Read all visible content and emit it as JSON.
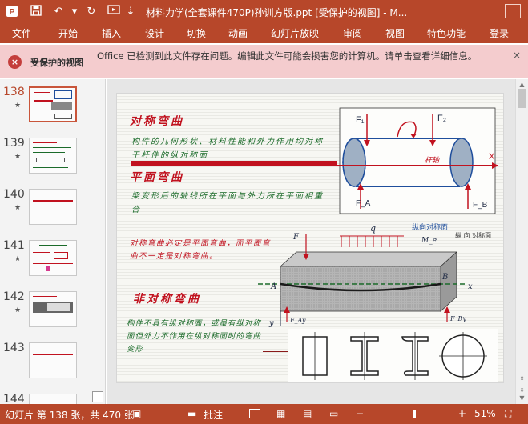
{
  "window": {
    "title": "材料力学(全套课件470P)孙训方版.ppt [受保护的视图] - M..."
  },
  "ribbon": {
    "tabs": [
      "文件",
      "开始",
      "插入",
      "设计",
      "切换",
      "动画",
      "幻灯片放映",
      "审阅",
      "视图",
      "特色功能",
      "登录"
    ]
  },
  "protected_view": {
    "title": "受保护的视图",
    "message": "Office 已检测到此文件存在问题。编辑此文件可能会损害您的计算机。请单击查看详细信息。",
    "close": "×"
  },
  "thumbnails": [
    {
      "number": "138",
      "star": "★",
      "selected": true
    },
    {
      "number": "139",
      "star": "★",
      "selected": false
    },
    {
      "number": "140",
      "star": "★",
      "selected": false
    },
    {
      "number": "141",
      "star": "★",
      "selected": false
    },
    {
      "number": "142",
      "star": "★",
      "selected": false
    },
    {
      "number": "143",
      "star": "",
      "selected": false
    },
    {
      "number": "144",
      "star": "",
      "selected": false
    }
  ],
  "slide": {
    "heading1": "对称弯曲",
    "text1": "构件的几何形状、材料性能和外力作用均对称于杆件的纵对称面",
    "heading2": "平面弯曲",
    "text2": "梁变形后的轴线所在平面与外力所在平面相重合",
    "text3": "对称弯曲必定是平面弯曲，而平面弯曲不一定是对称弯曲。",
    "heading3": "非对称弯曲",
    "text4": "构件不具有纵对称面，或虽有纵对称面但外力不作用在纵对称面时的弯曲变形",
    "fig1": {
      "F1": "F₁",
      "F2": "F₂",
      "FA": "F_A",
      "FB": "F_B",
      "axis_label": "杆轴",
      "x_label": "X"
    },
    "fig2": {
      "plane_label": "纵向对称面",
      "q": "q",
      "F": "F",
      "Me": "M_e",
      "A": "A",
      "B": "B",
      "x": "x",
      "y": "y",
      "FAy": "F_Ay",
      "FBy": "F_By",
      "side_label": "纵 向 对称面"
    }
  },
  "statusbar": {
    "slide_info": "幻灯片 第 138 张，共 470 张",
    "notes": "批注",
    "zoom": "51%"
  },
  "colors": {
    "accent": "#b7472a",
    "protected_bg": "#f4ccce",
    "slide_red": "#c1121f",
    "slide_green": "#1b6b2a",
    "diagram_blue": "#1f4e9c"
  }
}
